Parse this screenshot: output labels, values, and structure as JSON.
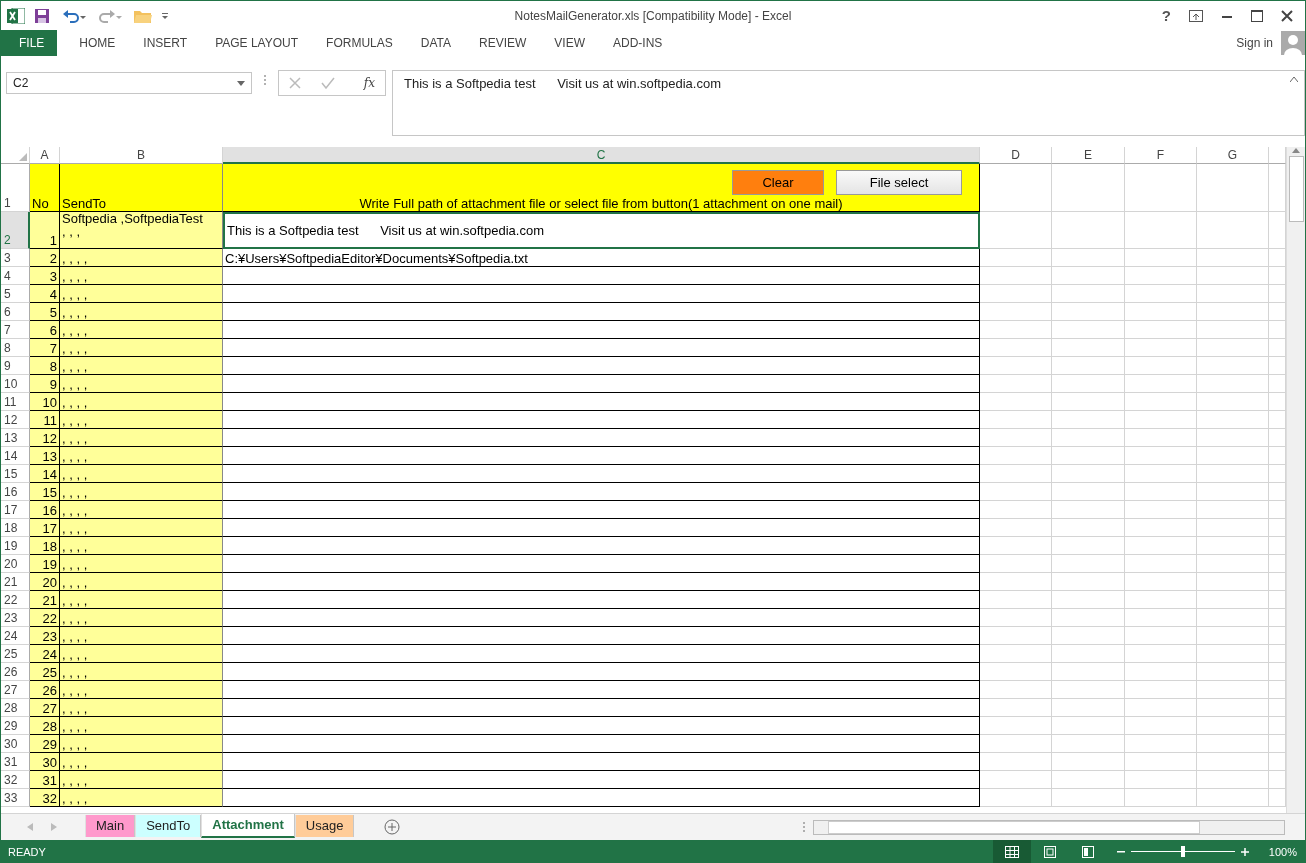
{
  "window": {
    "title": "NotesMailGenerator.xls  [Compatibility Mode] - Excel",
    "help": "?"
  },
  "ribbon": {
    "tabs": [
      {
        "label": "FILE",
        "kind": "file"
      },
      {
        "label": "HOME",
        "kind": "tab"
      },
      {
        "label": "INSERT",
        "kind": "tab"
      },
      {
        "label": "PAGE LAYOUT",
        "kind": "tab"
      },
      {
        "label": "FORMULAS",
        "kind": "tab"
      },
      {
        "label": "DATA",
        "kind": "tab"
      },
      {
        "label": "REVIEW",
        "kind": "tab"
      },
      {
        "label": "VIEW",
        "kind": "tab"
      },
      {
        "label": "ADD-INS",
        "kind": "tab"
      }
    ],
    "sign_in": "Sign in"
  },
  "formula_bar": {
    "name_box": "C2",
    "function_label": "fx",
    "value": "This is a Softpedia test      Visit us at win.softpedia.com"
  },
  "sheet": {
    "columns": [
      {
        "label": "A",
        "selected": false
      },
      {
        "label": "B",
        "selected": false
      },
      {
        "label": "C",
        "selected": true
      },
      {
        "label": "D",
        "selected": false
      },
      {
        "label": "E",
        "selected": false
      },
      {
        "label": "F",
        "selected": false
      },
      {
        "label": "G",
        "selected": false
      }
    ],
    "header_row": {
      "row": "1",
      "no": "No",
      "send_to": "SendTo",
      "attachment": "Write Full path of attachment file or select file from button(1 attachment on one mail)",
      "buttons": [
        {
          "label": "Clear",
          "kind": "clear"
        },
        {
          "label": "File select",
          "kind": "select"
        }
      ]
    },
    "rows": [
      {
        "row": "2",
        "selected": true,
        "no": "1",
        "send_to": "Softpedia ,SoftpediaTest\n, , ,",
        "attachment": "This is a Softpedia test      Visit us at win.softpedia.com"
      },
      {
        "row": "3",
        "selected": false,
        "no": "2",
        "send_to": ", , , ,",
        "attachment": "C:¥Users¥SoftpediaEditor¥Documents¥Softpedia.txt"
      },
      {
        "row": "4",
        "selected": false,
        "no": "3",
        "send_to": ", , , ,"
      },
      {
        "row": "5",
        "selected": false,
        "no": "4",
        "send_to": ", , , ,"
      },
      {
        "row": "6",
        "selected": false,
        "no": "5",
        "send_to": ", , , ,"
      },
      {
        "row": "7",
        "selected": false,
        "no": "6",
        "send_to": ", , , ,"
      },
      {
        "row": "8",
        "selected": false,
        "no": "7",
        "send_to": ", , , ,"
      },
      {
        "row": "9",
        "selected": false,
        "no": "8",
        "send_to": ", , , ,"
      },
      {
        "row": "10",
        "selected": false,
        "no": "9",
        "send_to": ", , , ,"
      },
      {
        "row": "11",
        "selected": false,
        "no": "10",
        "send_to": ", , , ,"
      },
      {
        "row": "12",
        "selected": false,
        "no": "11",
        "send_to": ", , , ,"
      },
      {
        "row": "13",
        "selected": false,
        "no": "12",
        "send_to": ", , , ,"
      },
      {
        "row": "14",
        "selected": false,
        "no": "13",
        "send_to": ", , , ,"
      },
      {
        "row": "15",
        "selected": false,
        "no": "14",
        "send_to": ", , , ,"
      },
      {
        "row": "16",
        "selected": false,
        "no": "15",
        "send_to": ", , , ,"
      },
      {
        "row": "17",
        "selected": false,
        "no": "16",
        "send_to": ", , , ,"
      },
      {
        "row": "18",
        "selected": false,
        "no": "17",
        "send_to": ", , , ,"
      },
      {
        "row": "19",
        "selected": false,
        "no": "18",
        "send_to": ", , , ,"
      },
      {
        "row": "20",
        "selected": false,
        "no": "19",
        "send_to": ", , , ,"
      },
      {
        "row": "21",
        "selected": false,
        "no": "20",
        "send_to": ", , , ,"
      },
      {
        "row": "22",
        "selected": false,
        "no": "21",
        "send_to": ", , , ,"
      },
      {
        "row": "23",
        "selected": false,
        "no": "22",
        "send_to": ", , , ,"
      },
      {
        "row": "24",
        "selected": false,
        "no": "23",
        "send_to": ", , , ,"
      },
      {
        "row": "25",
        "selected": false,
        "no": "24",
        "send_to": ", , , ,"
      },
      {
        "row": "26",
        "selected": false,
        "no": "25",
        "send_to": ", , , ,"
      },
      {
        "row": "27",
        "selected": false,
        "no": "26",
        "send_to": ", , , ,"
      },
      {
        "row": "28",
        "selected": false,
        "no": "27",
        "send_to": ", , , ,"
      },
      {
        "row": "29",
        "selected": false,
        "no": "28",
        "send_to": ", , , ,"
      },
      {
        "row": "30",
        "selected": false,
        "no": "29",
        "send_to": ", , , ,"
      },
      {
        "row": "31",
        "selected": false,
        "no": "30",
        "send_to": ", , , ,"
      },
      {
        "row": "32",
        "selected": false,
        "no": "31",
        "send_to": ", , , ,"
      },
      {
        "row": "33",
        "selected": false,
        "no": "32",
        "send_to": ", , , ,"
      }
    ]
  },
  "sheet_tabs": [
    {
      "label": "Main",
      "selected": false,
      "color": "#ff99cc"
    },
    {
      "label": "SendTo",
      "selected": false,
      "color": "#ccffff"
    },
    {
      "label": "Attachment",
      "selected": true,
      "color": "#ffffff"
    },
    {
      "label": "Usage",
      "selected": false,
      "color": "#ffcc99"
    }
  ],
  "status_bar": {
    "status": "READY",
    "zoom_slider": {
      "level": 0.5
    },
    "zoom": "100%"
  }
}
